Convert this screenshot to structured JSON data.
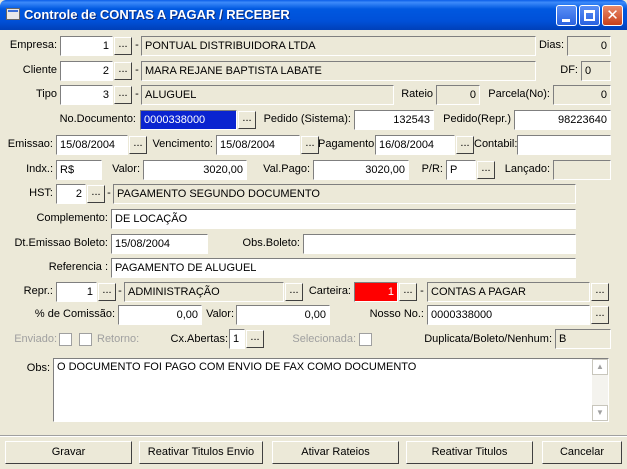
{
  "window": {
    "title": "Controle de CONTAS A PAGAR / RECEBER"
  },
  "fields": {
    "empresa": {
      "label": "Empresa:",
      "code": "1",
      "name": "PONTUAL DISTRIBUIDORA LTDA"
    },
    "dias": {
      "label": "Dias:",
      "value": "0"
    },
    "cliente": {
      "label": "Cliente",
      "code": "2",
      "name": "MARA REJANE BAPTISTA LABATE"
    },
    "df": {
      "label": "DF:",
      "value": "0"
    },
    "tipo": {
      "label": "Tipo",
      "code": "3",
      "name": "ALUGUEL"
    },
    "rateio": {
      "label": "Rateio",
      "value": "0"
    },
    "parcela": {
      "label": "Parcela(No):",
      "value": "0"
    },
    "no_documento": {
      "label": "No.Documento:",
      "value": "0000338000"
    },
    "pedido_sistema": {
      "label": "Pedido (Sistema):",
      "value": "132543"
    },
    "pedido_repr": {
      "label": "Pedido(Repr.)",
      "value": "98223640"
    },
    "emissao": {
      "label": "Emissao:",
      "value": "15/08/2004"
    },
    "vencimento": {
      "label": "Vencimento:",
      "value": "15/08/2004"
    },
    "pagamento": {
      "label": "Pagamento:",
      "value": "16/08/2004"
    },
    "contabil": {
      "label": "Contabil:",
      "value": ""
    },
    "indx": {
      "label": "Indx.:",
      "value": "R$"
    },
    "valor": {
      "label": "Valor:",
      "value": "3020,00"
    },
    "val_pago": {
      "label": "Val.Pago:",
      "value": "3020,00"
    },
    "pr": {
      "label": "P/R:",
      "value": "P"
    },
    "lancado": {
      "label": "Lançado:",
      "value": ""
    },
    "hst": {
      "label": "HST:",
      "code": "2",
      "name": "PAGAMENTO SEGUNDO DOCUMENTO"
    },
    "complemento": {
      "label": "Complemento:",
      "value": "DE LOCAÇÃO"
    },
    "dt_emissao_boleto": {
      "label": "Dt.Emissao Boleto:",
      "value": "15/08/2004"
    },
    "obs_boleto": {
      "label": "Obs.Boleto:",
      "value": ""
    },
    "referencia": {
      "label": "Referencia :",
      "value": "PAGAMENTO DE ALUGUEL"
    },
    "repr": {
      "label": "Repr.:",
      "code": "1",
      "name": "ADMINISTRAÇÃO"
    },
    "carteira": {
      "label": "Carteira:",
      "code": "1",
      "name": "CONTAS A PAGAR"
    },
    "comissao": {
      "label": "% de Comissão:",
      "value": "0,00"
    },
    "valor_comissao": {
      "label": "Valor:",
      "value": "0,00"
    },
    "nosso_no": {
      "label": "Nosso No.:",
      "value": "0000338000"
    },
    "enviado": {
      "label": "Enviado:"
    },
    "retorno": {
      "label": "Retorno:"
    },
    "cx_abertas": {
      "label": "Cx.Abertas:",
      "value": "1"
    },
    "selecionada": {
      "label": "Selecionada:"
    },
    "duplicata": {
      "label": "Duplicata/Boleto/Nenhum:",
      "value": "B"
    },
    "obs": {
      "label": "Obs:",
      "value": "O DOCUMENTO FOI PAGO COM ENVIO DE FAX COMO DOCUMENTO"
    }
  },
  "ellipsis": "...",
  "dash": "-",
  "buttons": {
    "gravar": "Gravar",
    "reativar_envio": "Reativar Titulos Envio",
    "ativar_rateios": "Ativar Rateios",
    "reativar_titulos": "Reativar Titulos",
    "cancelar": "Cancelar"
  },
  "colors": {
    "titlebar": "#0058e0",
    "selection": "#0a24d0",
    "carteira_highlight": "#ff0000",
    "face": "#ece9d8"
  }
}
